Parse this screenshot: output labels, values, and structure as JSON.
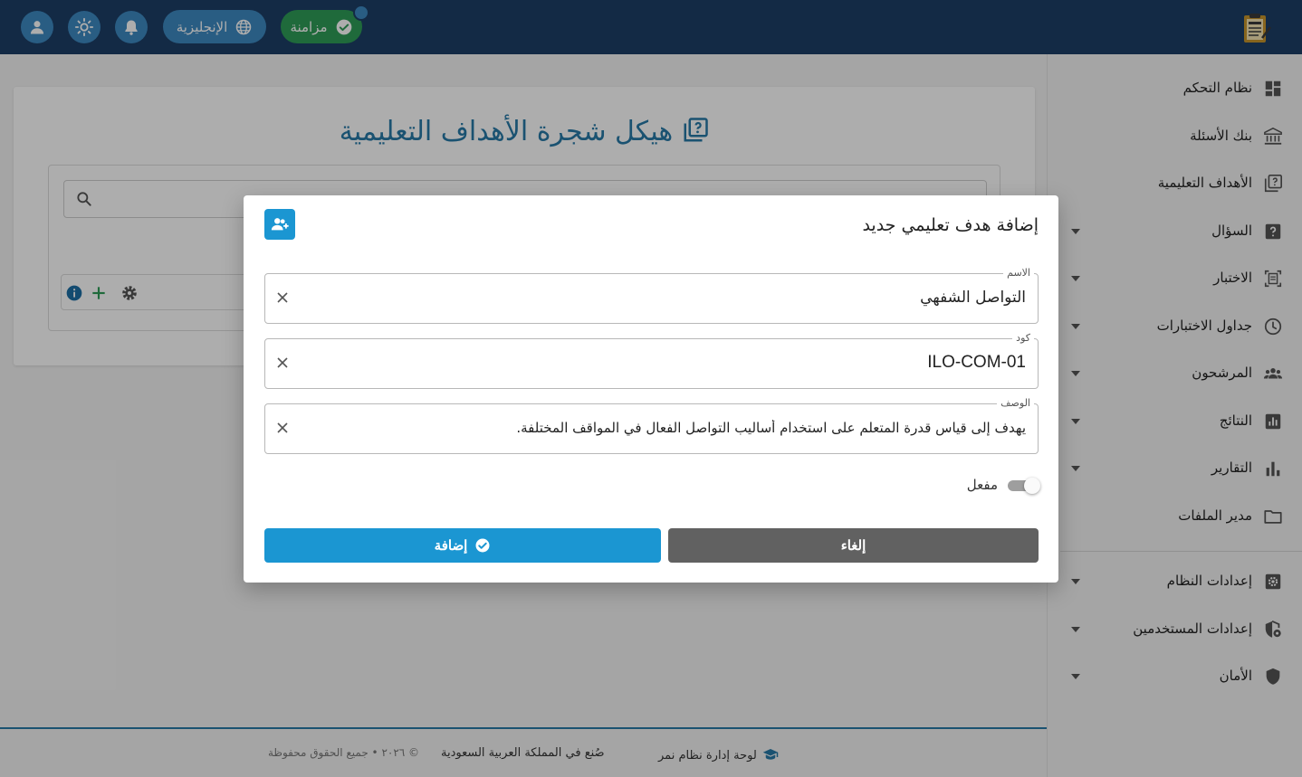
{
  "topbar": {
    "language_label": "الإنجليزية",
    "sync_label": "مزامنة",
    "icons": [
      "user-icon",
      "sun-icon",
      "bell-icon",
      "globe-icon",
      "check-circle-icon",
      "exam-logo-icon"
    ]
  },
  "sidebar": {
    "items": [
      {
        "label": "نظام التحكم",
        "icon": "dashboard-icon",
        "has_caret": false
      },
      {
        "label": "بنك الأسئلة",
        "icon": "bank-icon",
        "has_caret": false
      },
      {
        "label": "الأهداف التعليمية",
        "icon": "objectives-icon",
        "has_caret": false
      },
      {
        "label": "السؤال",
        "icon": "question-icon",
        "has_caret": true
      },
      {
        "label": "الاختبار",
        "icon": "exam-icon",
        "has_caret": true
      },
      {
        "label": "جداول الاختبارات",
        "icon": "clock-icon",
        "has_caret": true
      },
      {
        "label": "المرشحون",
        "icon": "people-icon",
        "has_caret": true
      },
      {
        "label": "النتائج",
        "icon": "results-icon",
        "has_caret": true
      },
      {
        "label": "التقارير",
        "icon": "reports-icon",
        "has_caret": true
      },
      {
        "label": "مدير الملفات",
        "icon": "folder-icon",
        "has_caret": false
      },
      {
        "label": "إعدادات النظام",
        "icon": "settings-icon",
        "has_caret": true
      },
      {
        "label": "إعدادات المستخدمين",
        "icon": "user-settings-icon",
        "has_caret": true
      },
      {
        "label": "الأمان",
        "icon": "shield-icon",
        "has_caret": true
      }
    ]
  },
  "main": {
    "title": "هيكل شجرة الأهداف التعليمية"
  },
  "footer": {
    "brand": "لوحة إدارة نظام نمر",
    "made_in": "صُنع في المملكة العربية السعودية",
    "copyright": "© ٢٠٢٦ • جميع الحقوق محفوظة"
  },
  "modal": {
    "title": "إضافة هدف تعليمي جديد",
    "fields": {
      "name": {
        "label": "الاسم",
        "value": "التواصل الشفهي"
      },
      "code": {
        "label": "كود",
        "value": "ILO-COM-01"
      },
      "description": {
        "label": "الوصف",
        "value": "يهدف إلى قياس قدرة المتعلم على استخدام أساليب التواصل الفعال في المواقف المختلفة."
      }
    },
    "toggle": {
      "label": "مفعل",
      "enabled": true
    },
    "cancel_label": "إلغاء",
    "add_label": "إضافة"
  },
  "colors": {
    "topbar": "#1d3f66",
    "accent": "#1b96d2",
    "title_blue": "#2779a7",
    "sync_green": "#2e9d58",
    "cancel_grey": "#616161"
  }
}
